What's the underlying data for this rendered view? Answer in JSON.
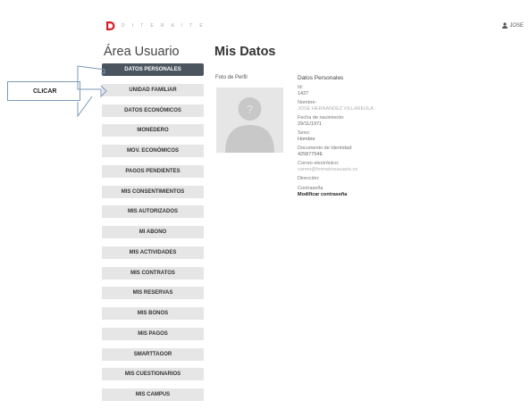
{
  "header": {
    "logo_text": "D I T E R A I T E",
    "user_name": "JOSE",
    "icons": {
      "logo": "d-logo-icon",
      "user": "user-icon"
    },
    "brand_color": "#d6202a"
  },
  "sidebar": {
    "title": "Área Usuario",
    "items": [
      {
        "label": "DATOS PERSONALES",
        "active": true
      },
      {
        "label": "UNIDAD FAMILIAR"
      },
      {
        "label": "DATOS ECONÓMICOS"
      },
      {
        "label": "MONEDERO"
      },
      {
        "label": "MOV. ECONÓMICOS"
      },
      {
        "label": "PAGOS PENDIENTES"
      },
      {
        "label": "MIS CONSENTIMIENTOS"
      },
      {
        "label": "MIS AUTORIZADOS"
      },
      {
        "label": "MI ABONO"
      },
      {
        "label": "MIS ACTIVIDADES"
      },
      {
        "label": "MIS CONTRATOS"
      },
      {
        "label": "MIS RESERVAS"
      },
      {
        "label": "MIS BONOS"
      },
      {
        "label": "MIS PAGOS"
      },
      {
        "label": "SMARTTAGOR"
      },
      {
        "label": "MIS CUESTIONARIOS"
      },
      {
        "label": "MIS CAMPUS"
      }
    ]
  },
  "annotation": {
    "label": "CLICAR",
    "icon": "arrow-right-icon"
  },
  "main": {
    "title": "Mis Datos",
    "photo_label": "Foto de Perfil",
    "avatar_icon": "user-avatar-icon",
    "section_title": "Datos Personales",
    "fields": {
      "id_label": "Id:",
      "id_value": "1427",
      "name_label": "Nombre:",
      "name_value": "JOSE HERNANDEZ VILLAREULA",
      "birth_label": "Fecha de nacimiento:",
      "birth_value": "29/11/1971",
      "sex_label": "Sexo:",
      "sex_value": "Hombre",
      "doc_label": "Documento de Identidad:",
      "doc_value": "42587754E",
      "email_label": "Correo electrónico:",
      "email_value": "carmo@formeinsusuario.co",
      "address_label": "Dirección:",
      "password_label": "Contraseña",
      "password_link": "Modificar contraseña"
    }
  }
}
